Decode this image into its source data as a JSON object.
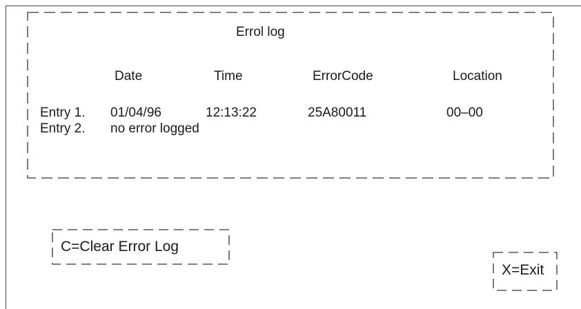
{
  "log": {
    "title": "Errol log",
    "columns": {
      "date": "Date",
      "time": "Time",
      "error_code": "ErrorCode",
      "location": "Location"
    },
    "entries": [
      {
        "label": "Entry 1.",
        "date": "01/04/96",
        "time": "12:13:22",
        "error_code": "25A80011",
        "location": "00–00"
      },
      {
        "label": "Entry 2.",
        "message": "no error logged"
      }
    ]
  },
  "actions": {
    "clear_label": "C=Clear Error Log",
    "exit_label": "X=Exit"
  }
}
